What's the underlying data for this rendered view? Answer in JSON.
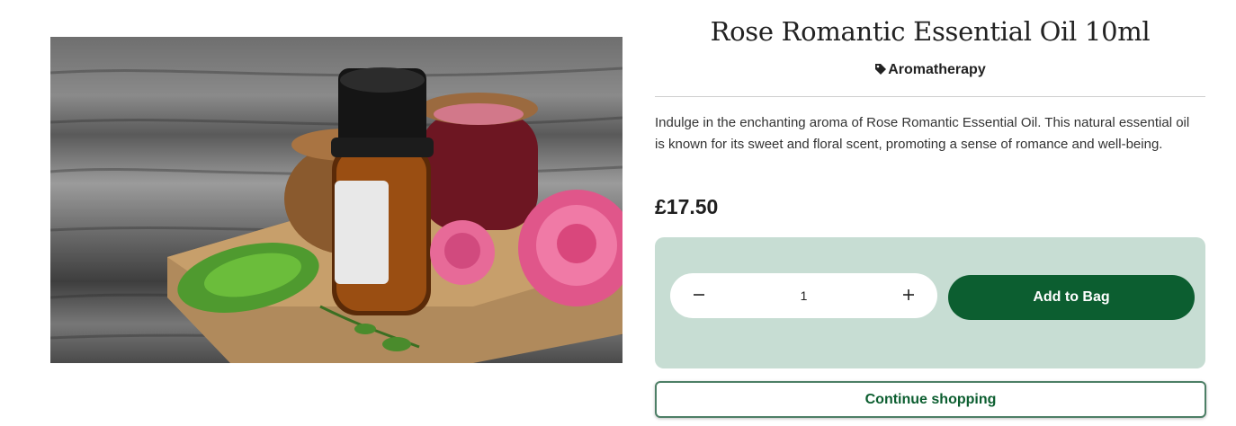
{
  "product": {
    "title": "Rose Romantic Essential Oil 10ml",
    "category": "Aromatherapy",
    "category_icon": "tag-icon",
    "description": "Indulge in the enchanting aroma of Rose Romantic Essential Oil. This natural essential oil is known for its sweet and floral scent, promoting a sense of romance and well-being.",
    "price": "£17.50",
    "image_icon": "product-photo"
  },
  "quantity": {
    "value": "1",
    "decrement_icon": "minus-icon",
    "increment_icon": "plus-icon"
  },
  "actions": {
    "add_to_bag": "Add to Bag",
    "continue_shopping": "Continue shopping"
  },
  "colors": {
    "primary_green": "#0c5e30",
    "panel_bg": "#c7ddd3",
    "divider": "#cfcfcf"
  }
}
